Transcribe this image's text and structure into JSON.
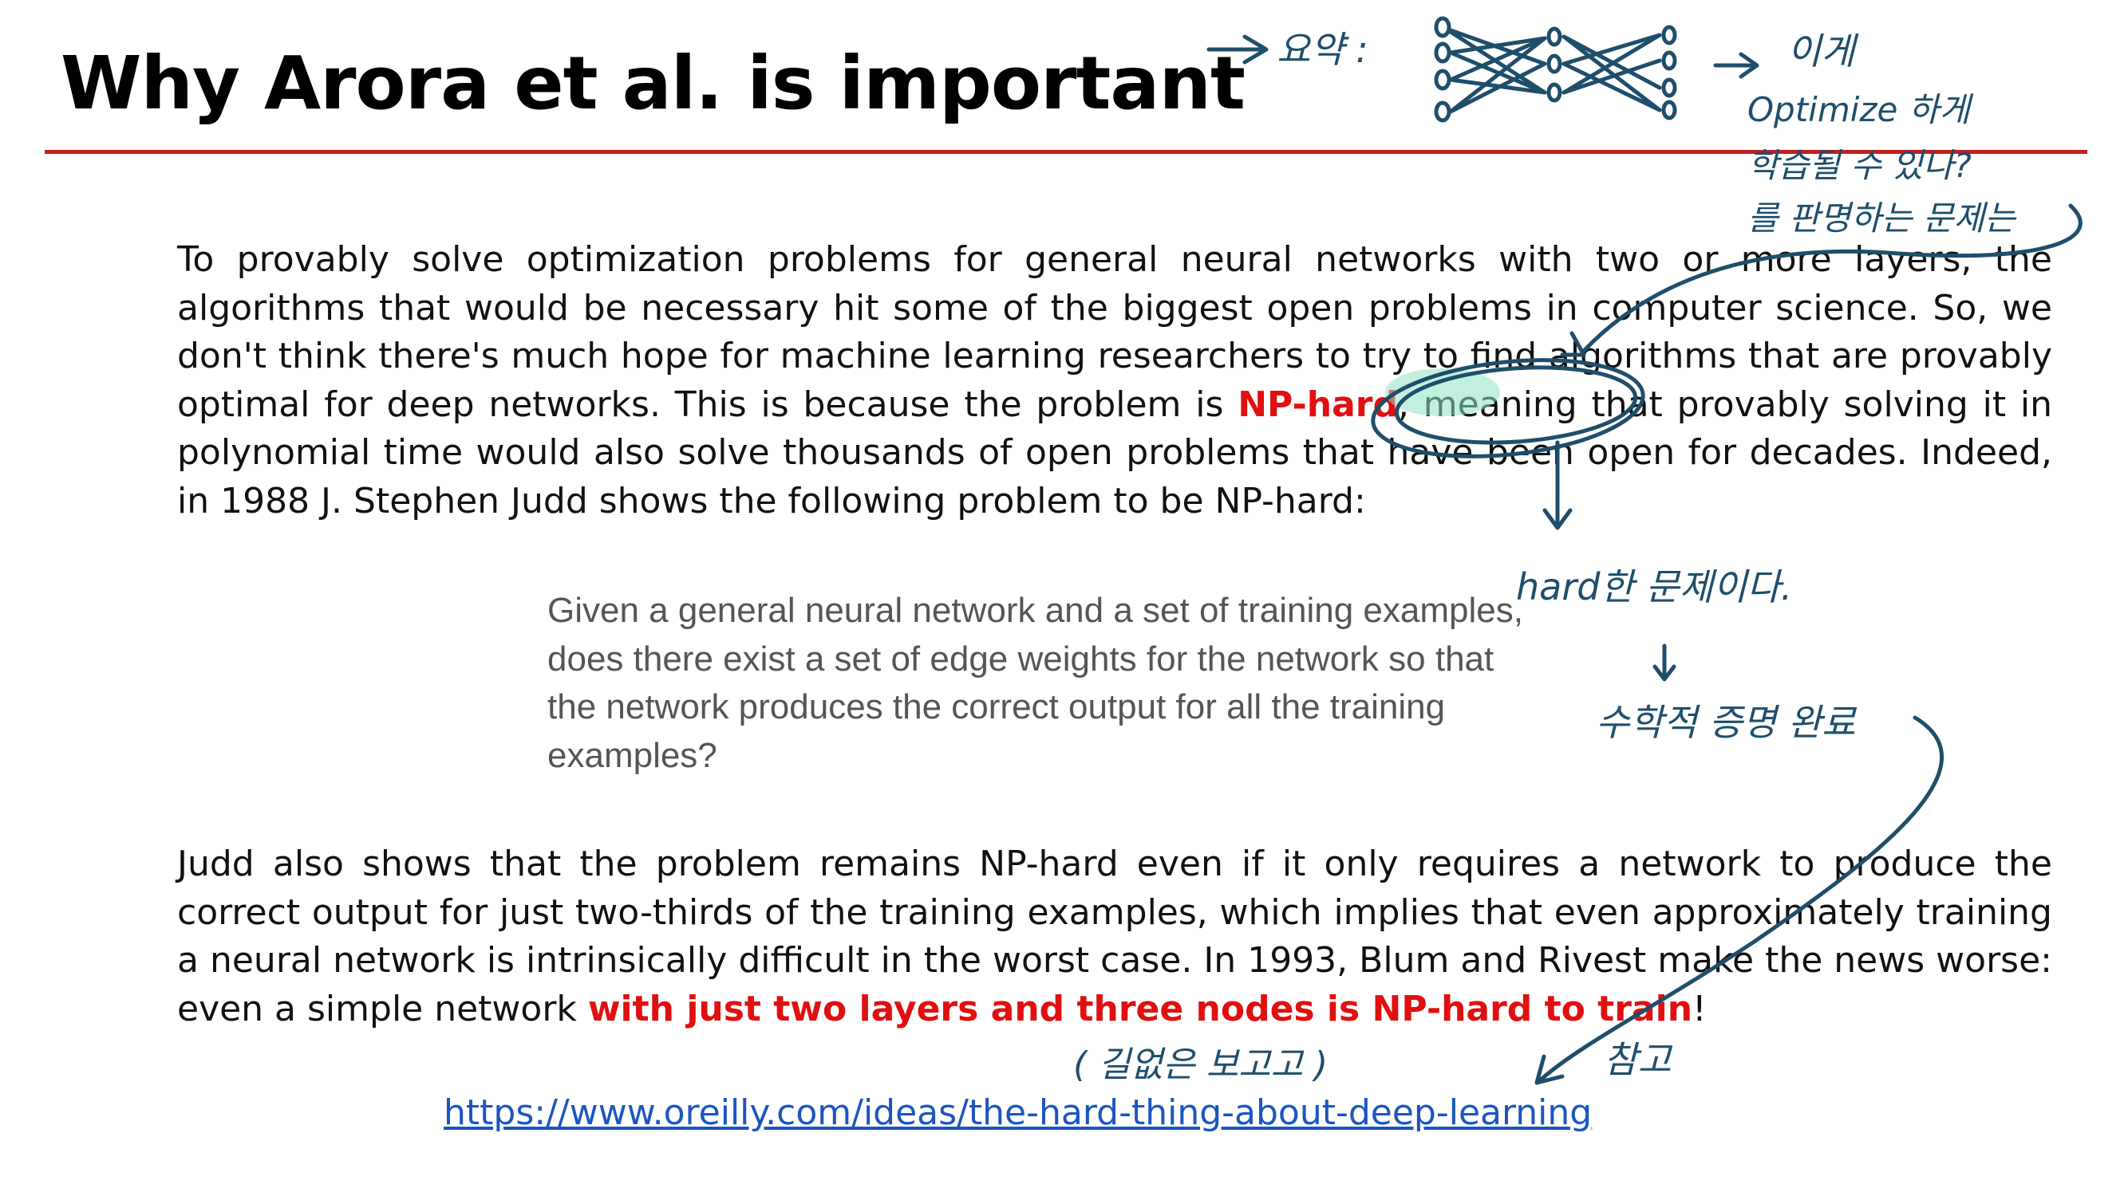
{
  "slide": {
    "title": "Why Arora et al. is important",
    "paragraph1": {
      "before": "To provably solve optimization problems for general neural networks with two or more layers, the algorithms that would be necessary hit some of the biggest open problems in computer science. So, we don't think there's much hope for machine learning researchers to try to find algorithms that are provably optimal for deep networks. This is because the problem is ",
      "highlight": "NP-hard",
      "after": ", meaning that provably solving it in polynomial time would also solve thousands of open problems that have been open for decades. Indeed, in 1988 J. Stephen Judd shows the following problem to be NP-hard:"
    },
    "quote": "Given a general neural network and a set of training examples, does there exist a set of edge weights for the network so that the network produces the correct output for all the training examples?",
    "paragraph2": {
      "before": "Judd also shows that the problem remains NP-hard even if it only requires a network to produce the correct output for just two-thirds of the training examples, which implies that even approximately training a neural network is intrinsically difficult in the worst case. In 1993, Blum and Rivest make the news worse: even a simple network ",
      "highlight": "with just two layers and three nodes is NP-hard to train",
      "after": "!"
    },
    "link": "https://www.oreilly.com/ideas/the-hard-thing-about-deep-learning"
  },
  "annotations": {
    "summary_label": "요약 :",
    "top_note_lines": [
      "이게",
      "Optimize 하게",
      "학습될 수 있나?",
      "를 판명하는 문제는"
    ],
    "hard_note": "hard한 문제이다.",
    "proof_note": "수학적 증명 완료",
    "skip_note": "( 길없은 보고고 )",
    "reference_note": "참고"
  },
  "colors": {
    "title_rule": "#c0201e",
    "highlight_red": "#e01010",
    "ink_blue": "#1f4e6b",
    "highlighter_green": "#8fe3c4",
    "link_blue": "#1a56c0",
    "quote_gray": "#555555"
  }
}
